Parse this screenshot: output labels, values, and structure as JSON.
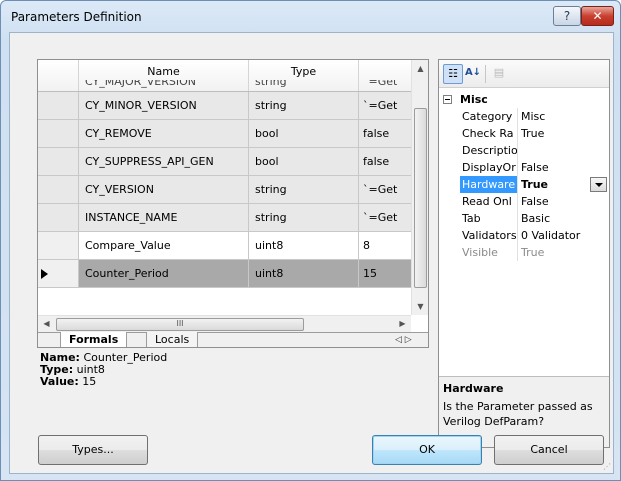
{
  "window": {
    "title": "Parameters Definition",
    "help_label": "?",
    "close_label": "✕"
  },
  "grid": {
    "columns": [
      "Name",
      "Type",
      ""
    ],
    "partial_row": [
      "CY_MAJOR_VERSION",
      "string",
      "`=Get"
    ],
    "rows": [
      {
        "name": "CY_MINOR_VERSION",
        "type": "string",
        "value": "`=Get",
        "style": "gray"
      },
      {
        "name": "CY_REMOVE",
        "type": "bool",
        "value": "false",
        "style": "gray"
      },
      {
        "name": "CY_SUPPRESS_API_GEN",
        "type": "bool",
        "value": "false",
        "style": "gray"
      },
      {
        "name": "CY_VERSION",
        "type": "string",
        "value": "`=Get",
        "style": "gray"
      },
      {
        "name": "INSTANCE_NAME",
        "type": "string",
        "value": "`=Get",
        "style": "gray"
      },
      {
        "name": "Compare_Value",
        "type": "uint8",
        "value": "8",
        "style": "white"
      },
      {
        "name": "Counter_Period",
        "type": "uint8",
        "value": "15",
        "style": "sel"
      }
    ],
    "hscroll_grip": "III"
  },
  "tabs": {
    "formals": "Formals",
    "locals": "Locals",
    "nav": "◁ ▷"
  },
  "info": {
    "name_label": "Name:",
    "name_value": "Counter_Period",
    "type_label": "Type:",
    "type_value": "uint8",
    "value_label": "Value:",
    "value_value": "15"
  },
  "properties": {
    "category": "Misc",
    "items": [
      {
        "name": "Category",
        "value": "Misc"
      },
      {
        "name": "Check Ra",
        "value": "True"
      },
      {
        "name": "Descriptio",
        "value": ""
      },
      {
        "name": "DisplayOr",
        "value": "False"
      },
      {
        "name": "Hardware",
        "value": "True"
      },
      {
        "name": "Read Onl",
        "value": "False"
      },
      {
        "name": "Tab",
        "value": "Basic"
      },
      {
        "name": "Validators",
        "value": "0 Validator"
      },
      {
        "name": "Visible",
        "value": "True"
      }
    ],
    "help_title": "Hardware",
    "help_desc": "Is the Parameter passed as Verilog DefParam?"
  },
  "buttons": {
    "types": "Types...",
    "ok": "OK",
    "cancel": "Cancel"
  }
}
